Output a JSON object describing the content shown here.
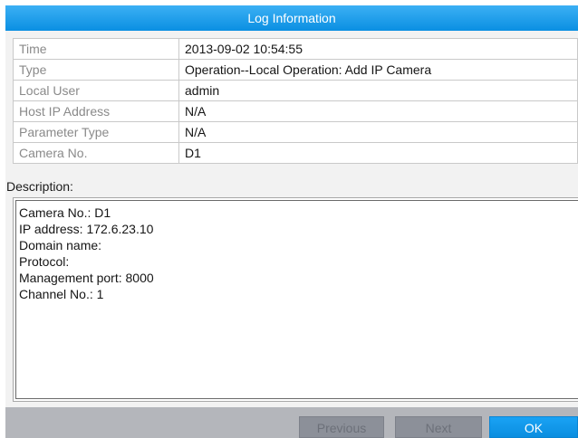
{
  "dialog": {
    "title": "Log Information"
  },
  "info_rows": [
    {
      "label": "Time",
      "value": "2013-09-02 10:54:55"
    },
    {
      "label": "Type",
      "value": "Operation--Local Operation: Add IP Camera"
    },
    {
      "label": "Local User",
      "value": "admin"
    },
    {
      "label": "Host IP Address",
      "value": "N/A"
    },
    {
      "label": "Parameter Type",
      "value": "N/A"
    },
    {
      "label": "Camera No.",
      "value": "D1"
    }
  ],
  "description": {
    "label": "Description:",
    "lines": [
      "Camera No.: D1",
      "IP address: 172.6.23.10",
      "Domain name:",
      "Protocol:",
      "Management port: 8000",
      "Channel No.: 1"
    ]
  },
  "buttons": {
    "previous": "Previous",
    "next": "Next",
    "ok": "OK"
  },
  "colors": {
    "title_bar": "#0a8fe2",
    "primary_button": "#1aa2f4",
    "footer": "#b4b6bb"
  },
  "icons": {
    "scroll_up": "triangle-up-icon",
    "scroll_down": "triangle-down-icon"
  }
}
